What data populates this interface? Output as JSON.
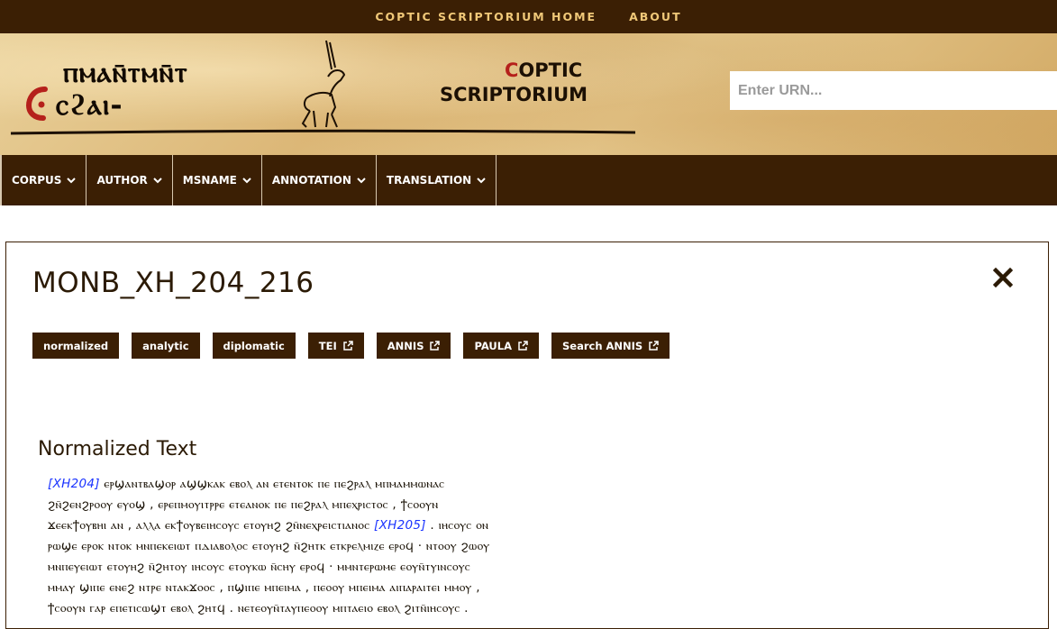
{
  "topbar": {
    "links": [
      "COPTIC SCRIPTORIUM HOME",
      "ABOUT"
    ]
  },
  "banner": {
    "logo_coptic_line1": "ⲡⲙⲁⲛ̄ⲧⲙⲛ̄ⲧ",
    "logo_coptic_line2": "ⲥϩⲁⲓ-",
    "title_line1_initial": "C",
    "title_line1_rest": "OPTIC",
    "title_line2": "SCRIPTORIUM"
  },
  "search": {
    "placeholder": "Enter URN..."
  },
  "nav": {
    "items": [
      "CORPUS",
      "AUTHOR",
      "MSNAME",
      "ANNOTATION",
      "TRANSLATION"
    ]
  },
  "document": {
    "title": "MONB_XH_204_216",
    "buttons": [
      "normalized",
      "analytic",
      "diplomatic",
      "TEI",
      "ANNIS",
      "PAULA",
      "Search ANNIS"
    ],
    "section_title": "Normalized Text",
    "lines": [
      {
        "ref": "[XH204]",
        "text": " ⲉⲣϣⲁⲛⲧⲃⲁϣⲟⲣ ⲁϣϣⲕⲁⲕ ⲉⲃⲟⲗ ⲁⲛ ⲉⲧⲉⲛⲧⲟⲕ ⲡⲉ ⲡⲉϩⲣⲁⲗ ⲙⲡⲙⲁⲙⲙⲱⲛⲁⲥ"
      },
      {
        "ref": "",
        "text": "ϩⲛ̄ϩⲉⲛϩⲣⲟⲟⲩ ⲉⲩⲟϣ , ⲉⲣⲉⲡⲙⲟⲩⲓⲧⲣⲣⲉ ⲉⲧⲉⲁⲛⲟⲕ ⲡⲉ ⲡⲉϩⲣⲁⲗ ⲙⲡⲉⲭⲣⲓⲥⲧⲟⲥ , ϯⲥⲟⲟⲩⲛ"
      },
      {
        "ref": "",
        "text": "ϫⲉⲉⲕϯⲟⲩⲃⲏⲓ ⲁⲛ , ⲁⲗⲗⲁ ⲉⲕϯⲟⲩⲃⲉⲓⲏⲥⲟⲩⲥ ⲉⲧⲟⲩⲏϩ ϩⲛ̄ⲛⲉⲭⲣⲉⲓⲥⲧⲓⲁⲛⲟⲥ",
        "ref_after": "[XH205]",
        "text_after": " . ⲓⲏⲥⲟⲩⲥ ⲟⲛ"
      },
      {
        "ref": "",
        "text": "ⲣⲱϣⲉ ⲉⲣⲟⲕ ⲛⲧⲟⲕ ⲙⲛⲡⲉⲕⲉⲓⲱⲧ ⲡⲇⲓⲁⲃⲟⲗⲟⲥ ⲉⲧⲟⲩⲏϩ ⲛ̄ϩⲏⲧⲕ ⲉⲧⲕⲣⲉⲗⲙⲓⲍⲉ ⲉⲣⲟϥ · ⲛⲧⲟⲟⲩ ϩⲱⲟⲩ"
      },
      {
        "ref": "",
        "text": "ⲙⲛⲡⲉⲩⲉⲓⲱⲧ ⲉⲧⲟⲩⲏϩ ⲛ̄ϩⲏⲧⲟⲩ ⲓⲏⲥⲟⲩⲥ ⲉⲧⲟⲩⲕⲱ ⲛ̄ⲥⲏⲩ ⲉⲣⲟϥ · ⲙⲙⲛⲧⲉⲣⲱⲙⲉ ⲉⲟⲩⲛ̄ⲧⲩⲓⲛⲥⲟⲩⲥ"
      },
      {
        "ref": "",
        "text": "ⲙⲙⲁⲩ ϣⲓⲡⲉ ⲉⲛⲉϩ ⲛⲧⲣⲉ ⲛⲧⲁⲕϫⲟⲟⲥ , ⲡϣⲓⲡⲉ ⲙⲡⲉⲓⲙⲁ , ⲡⲉⲟⲟⲩ ⲙⲡⲉⲓⲙⲁ ⲁⲓⲡⲁⲣⲁⲓⲧⲉⲓ ⲙⲙⲟⲩ ,"
      },
      {
        "ref": "",
        "text": "ϯⲥⲟⲟⲩⲛ ⲅⲁⲣ ⲉⲡⲉⲧⲓⲥⲱϣⲧ ⲉⲃⲟⲗ ϩⲏⲧϥ . ⲛⲉⲧⲉⲟⲩⲛ̄ⲧⲁⲩⲡⲉⲟⲟⲩ ⲙⲡⲧⲁⲉⲓⲟ ⲉⲃⲟⲗ ϩⲓⲧⲛ̄ⲓⲏⲥⲟⲩⲥ ."
      }
    ]
  },
  "colors": {
    "brand_dark": "#3b1f04",
    "accent_gold": "#f0c878",
    "ref_blue": "#1a33ff",
    "logo_red": "#b5201b"
  },
  "icons": {
    "close": "close-icon",
    "external": "external-link-icon",
    "chevron": "chevron-down-icon"
  }
}
